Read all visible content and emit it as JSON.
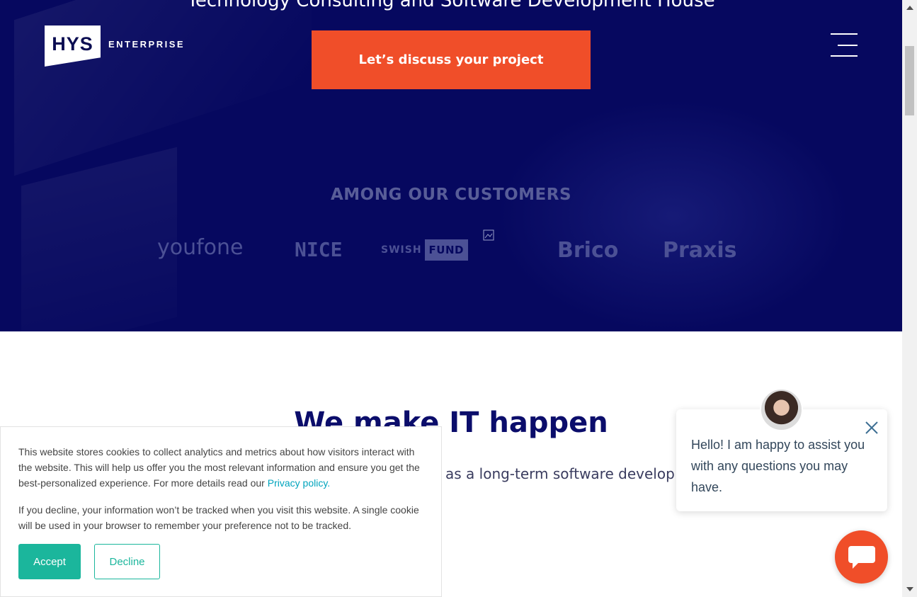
{
  "hero": {
    "title": "Technology Consulting and Software Development House",
    "cta_label": "Let’s discuss your project",
    "customers_title": "AMONG OUR CUSTOMERS"
  },
  "logo": {
    "mark": "HYS",
    "text": "ENTERPRISE"
  },
  "customers": {
    "youfone": "youfone",
    "nice": "NICE",
    "swish_word": "SWISH",
    "fund_word": "FUND",
    "brico": "Brico",
    "praxis": "Praxis"
  },
  "main": {
    "title": "We make IT happen",
    "subtitle_visible": "as a long-term software develop"
  },
  "cookie": {
    "text1": "This website stores cookies to collect analytics and metrics about how visitors interact with the website. This will help us offer you the most relevant information and ensure you get the best-personalized experience. For more details read our ",
    "privacy_link": "Privacy policy.",
    "text2": "If you decline, your information won’t be tracked when you visit this website. A single cookie will be used in your browser to remember your preference not to be tracked.",
    "accept_label": "Accept",
    "decline_label": "Decline"
  },
  "chat": {
    "message": "Hello! I am happy to assist you with any questions you may have."
  },
  "colors": {
    "hero_bg": "#06085f",
    "accent_orange": "#f04e29",
    "teal": "#1bb69c",
    "link": "#00a4bd",
    "heading": "#0b0d6b"
  },
  "icons": [
    "hamburger-menu-icon",
    "broken-image-icon",
    "close-icon",
    "chat-bubble-icon",
    "avatar"
  ]
}
